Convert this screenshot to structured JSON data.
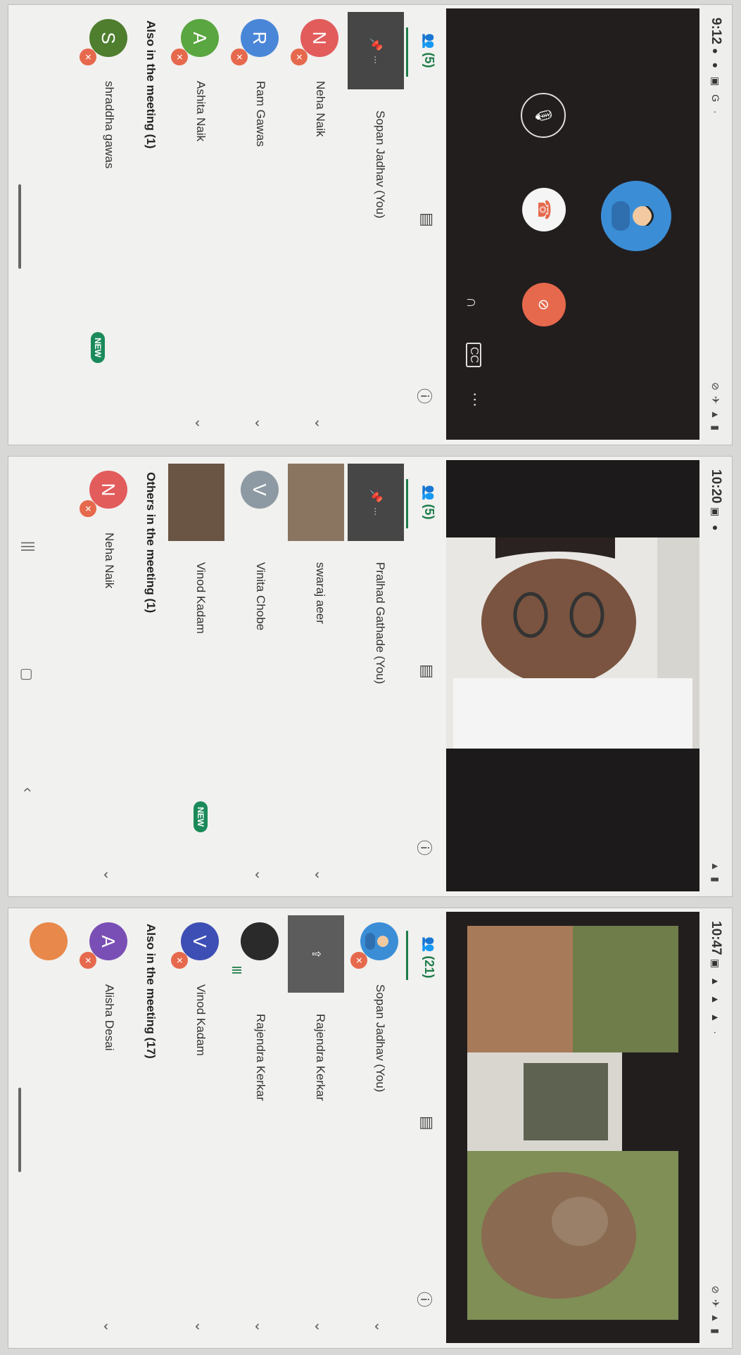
{
  "panel1": {
    "time": "9:12",
    "status_icons_left": "● ● ▣ G ·",
    "status_icons_right": "⊘ ✈ ▲ ▮",
    "avatar_icon": "user-avatar-icon",
    "tabs": {
      "people_count": "(5)"
    },
    "participants": [
      {
        "name": "Sopan Jadhav (You)",
        "initial": ""
      },
      {
        "name": "Neha Naik",
        "initial": "N",
        "color": "#e25c5c"
      },
      {
        "name": "Ram Gawas",
        "initial": "R",
        "color": "#4a86d8"
      },
      {
        "name": "Ashita Naik",
        "initial": "A",
        "color": "#5aa640"
      }
    ],
    "also_label": "Also in the meeting (1)",
    "also": [
      {
        "name": "shraddha gawas",
        "initial": "S",
        "color": "#4e7e2e"
      }
    ],
    "new_badge": "NEW"
  },
  "panel2": {
    "time": "10:20",
    "status_icons_left": "▣ ●",
    "status_icons_right": "▲ ▮",
    "tabs": {
      "people_count": "(5)"
    },
    "participants": [
      {
        "name": "Pralhad Gathade (You)"
      },
      {
        "name": "swaraj aeer"
      },
      {
        "name": "Vinita Chobe",
        "initial": "V",
        "color": "#8e9aa3"
      },
      {
        "name": "Vinod Kadam"
      }
    ],
    "others_label": "Others in the meeting (1)",
    "others": [
      {
        "name": "Neha Naik",
        "initial": "N",
        "color": "#e25c5c"
      }
    ],
    "new_badge": "NEW"
  },
  "panel3": {
    "time": "10:47",
    "status_icons_left": "▣ ▲ ▲ ▲ ·",
    "status_icons_right": "⊘ ✈ ▲ ▮",
    "tabs": {
      "people_count": "(21)"
    },
    "participants": [
      {
        "name": "Sopan Jadhav (You)"
      },
      {
        "name": "Rajendra Kerkar"
      },
      {
        "name": "Rajendra Kerkar"
      },
      {
        "name": "Vinod Kadam",
        "initial": "V",
        "color": "#3d4fb5"
      }
    ],
    "also_label": "Also in the meeting (17)",
    "also": [
      {
        "name": "Alisha Desai",
        "initial": "A",
        "color": "#7a4fb5"
      }
    ]
  },
  "colors": {
    "accent_green": "#1e7c4a",
    "end_call_red": "#e6694d",
    "video_bg": "#231e1e"
  },
  "icons": [
    "people-icon",
    "chat-icon",
    "info-icon",
    "mic-off-icon",
    "pin-icon",
    "chevron-down-icon",
    "end-call-icon",
    "video-off-icon",
    "headphones-icon",
    "captions-icon",
    "more-icon",
    "present-icon"
  ]
}
